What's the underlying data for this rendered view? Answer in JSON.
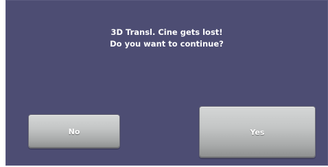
{
  "dialog": {
    "message_line1": "3D Transl. Cine gets lost!",
    "message_line2": "Do you want to continue?",
    "no_label": "No",
    "yes_label": "Yes"
  },
  "colors": {
    "dialog_background": "#4d4d73",
    "text": "#ffffff",
    "button_face": "#c4c6c6"
  }
}
